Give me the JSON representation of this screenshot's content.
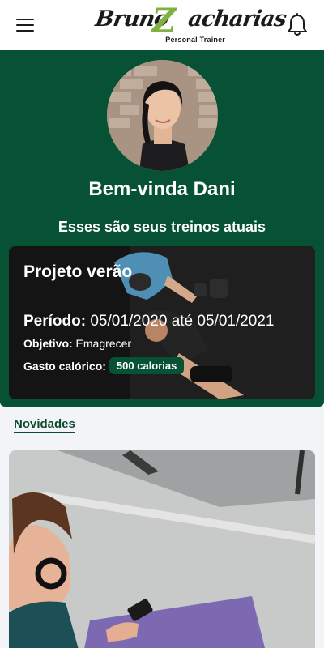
{
  "header": {
    "logo_text": "BrunoZacharias",
    "logo_subtitle": "Personal Trainer",
    "menu_icon": "hamburger-menu-icon",
    "notification_icon": "bell-icon"
  },
  "hero": {
    "welcome": "Bem-vinda Dani",
    "subtitle": "Esses são seus treinos atuais"
  },
  "workout": {
    "title": "Projeto verão",
    "period_label": "Período:",
    "period_value": " 05/01/2020 até 05/01/2021",
    "goal_label": "Objetivo:",
    "goal_value": " Emagrecer",
    "calories_label": "Gasto calórico:",
    "calories_value": "500 calorias"
  },
  "news": {
    "label": "Novidades"
  },
  "colors": {
    "brand_green": "#075235",
    "logo_accent": "#7fb241",
    "background": "#f2f4f7"
  }
}
